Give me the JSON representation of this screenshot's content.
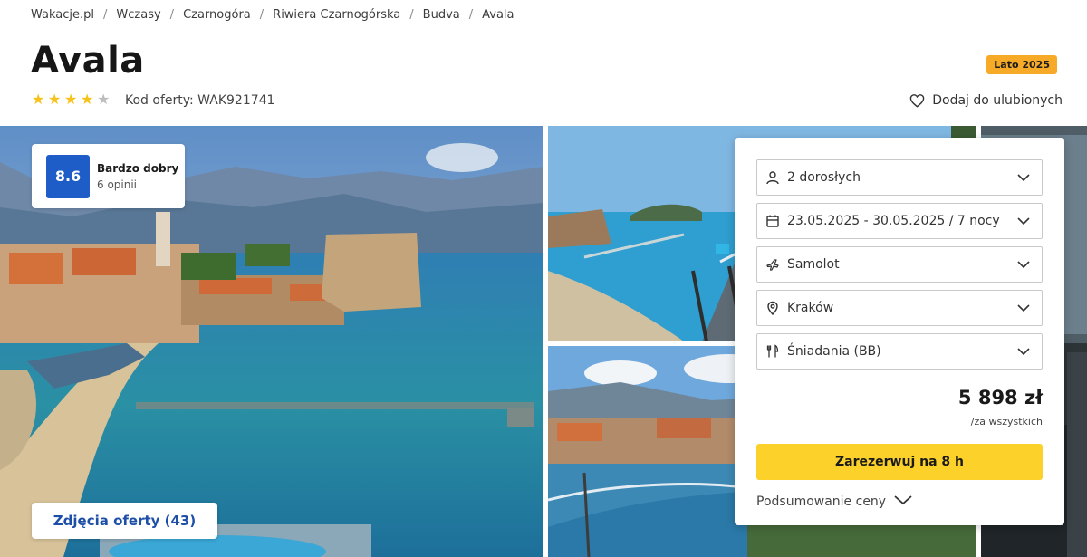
{
  "breadcrumb": {
    "items": [
      "Wakacje.pl",
      "Wczasy",
      "Czarnogóra",
      "Riwiera Czarnogórska",
      "Budva",
      "Avala"
    ],
    "separator": "/"
  },
  "title": "Avala",
  "season_badge": "Lato 2025",
  "stars": {
    "filled": 4,
    "total": 5
  },
  "offer_code": "Kod oferty: WAK921741",
  "favorite_label": "Dodaj do ulubionych",
  "rating": {
    "score": "8.6",
    "label": "Bardzo dobry",
    "count": "6 opinii"
  },
  "photos_button": "Zdjęcia oferty (43)",
  "booking": {
    "fields": [
      {
        "icon": "person-icon",
        "label": "2 dorosłych"
      },
      {
        "icon": "calendar-icon",
        "label": "23.05.2025 - 30.05.2025 / 7 nocy"
      },
      {
        "icon": "plane-icon",
        "label": "Samolot"
      },
      {
        "icon": "location-pin-icon",
        "label": "Kraków"
      },
      {
        "icon": "cutlery-icon",
        "label": "Śniadania (BB)"
      }
    ],
    "price": "5 898 zł",
    "price_note": "/za wszystkich",
    "book_button": "Zarezerwuj na 8 h",
    "summary_label": "Podsumowanie ceny"
  },
  "colors": {
    "accent_blue": "#1e5cc8",
    "book_yellow": "#fbd12a",
    "badge_orange": "#f7a928",
    "star_yellow": "#f7c31a"
  }
}
